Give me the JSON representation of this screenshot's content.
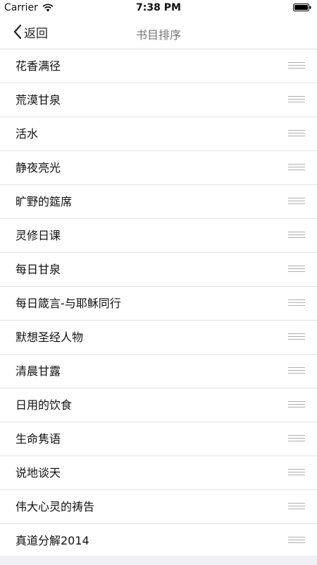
{
  "status_bar": {
    "carrier": "Carrier",
    "time": "7:38 PM"
  },
  "nav": {
    "back_label": "返回",
    "title": "书目排序"
  },
  "books": [
    "花香满径",
    "荒漠甘泉",
    "活水",
    "静夜亮光",
    "旷野的筵席",
    "灵修日课",
    "每日甘泉",
    "每日箴言-与耶稣同行",
    "默想圣经人物",
    "清晨甘露",
    "日用的饮食",
    "生命隽语",
    "说地谈天",
    "伟大心灵的祷告",
    "真道分解2014"
  ]
}
